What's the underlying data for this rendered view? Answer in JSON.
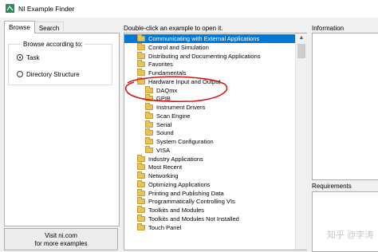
{
  "window": {
    "title": "NI Example Finder"
  },
  "tabs": [
    {
      "label": "Browse",
      "active": true
    },
    {
      "label": "Search",
      "active": false
    }
  ],
  "browse": {
    "group_label": "Browse according to:",
    "options": [
      {
        "label": "Task",
        "checked": true
      },
      {
        "label": "Directory Structure",
        "checked": false
      }
    ]
  },
  "visit_button": {
    "line1": "Visit ni.com",
    "line2": "for more examples"
  },
  "instruction": "Double-click an example to open it.",
  "tree": [
    {
      "label": "Communicating with External Applications",
      "level": 0,
      "selected": true
    },
    {
      "label": "Control and Simulation",
      "level": 0
    },
    {
      "label": "Distributing and Documenting Applications",
      "level": 0
    },
    {
      "label": "Favorites",
      "level": 0
    },
    {
      "label": "Fundamentals",
      "level": 0
    },
    {
      "label": "Hardware Input and Output",
      "level": 0,
      "expanded": true
    },
    {
      "label": "DAQmx",
      "level": 1
    },
    {
      "label": "GPIB",
      "level": 1
    },
    {
      "label": "Instrument Drivers",
      "level": 1
    },
    {
      "label": "Scan Engine",
      "level": 1
    },
    {
      "label": "Serial",
      "level": 1
    },
    {
      "label": "Sound",
      "level": 1
    },
    {
      "label": "System Configuration",
      "level": 1
    },
    {
      "label": "VISA",
      "level": 1
    },
    {
      "label": "Industry Applications",
      "level": 0
    },
    {
      "label": "Most Recent",
      "level": 0
    },
    {
      "label": "Networking",
      "level": 0
    },
    {
      "label": "Optimizing Applications",
      "level": 0
    },
    {
      "label": "Printing and Publishing Data",
      "level": 0
    },
    {
      "label": "Programmatically Controlling VIs",
      "level": 0
    },
    {
      "label": "Toolkits and Modules",
      "level": 0
    },
    {
      "label": "Toolkits and Modules Not Installed",
      "level": 0
    },
    {
      "label": "Touch Panel",
      "level": 0
    }
  ],
  "information": {
    "label": "Information"
  },
  "requirements": {
    "label": "Requirements"
  },
  "watermark": "知乎 @李涛",
  "colors": {
    "selection": "#0078d7",
    "annotation": "#d01818",
    "folder": "#e8c25b"
  }
}
